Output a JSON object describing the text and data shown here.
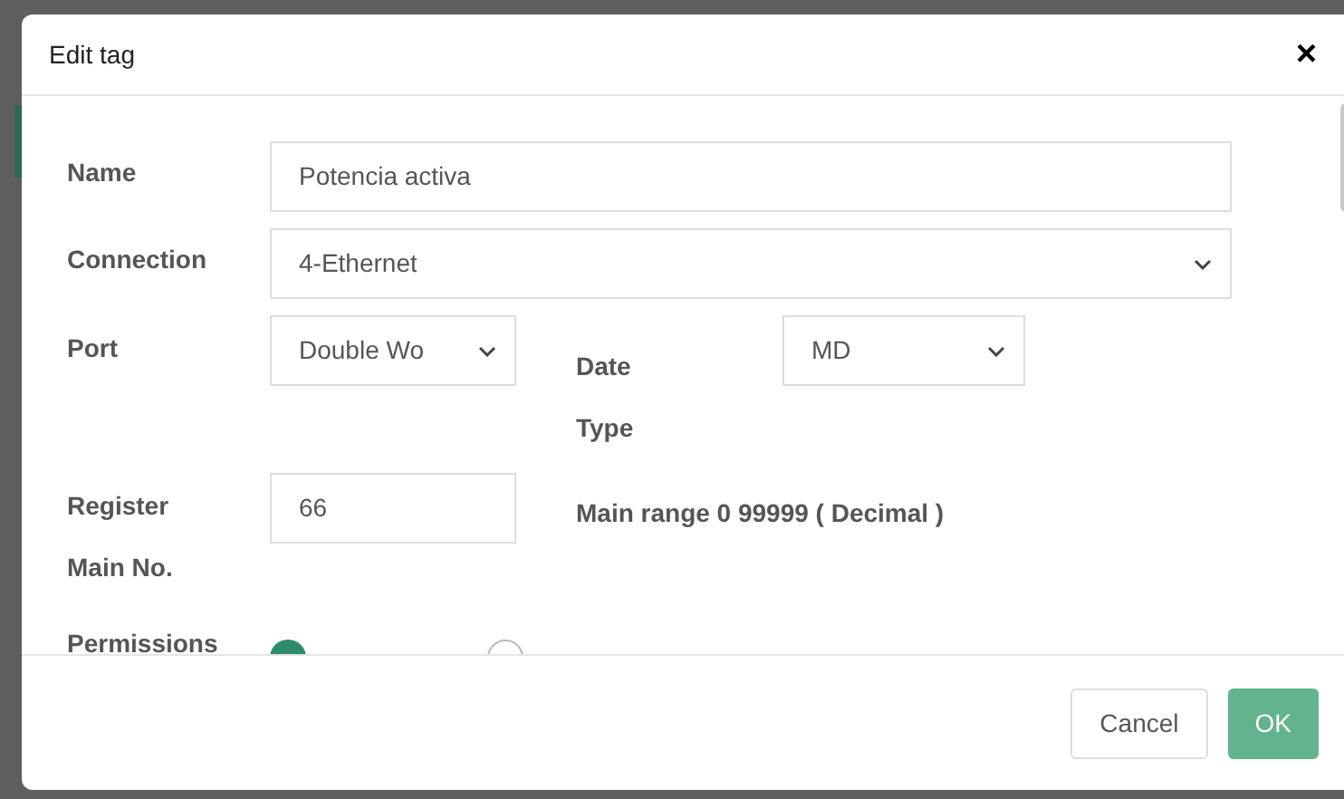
{
  "dialog": {
    "title": "Edit tag",
    "close": "×"
  },
  "form": {
    "name": {
      "label": "Name",
      "value": "Potencia activa"
    },
    "connection": {
      "label": "Connection",
      "value": "4-Ethernet"
    },
    "port": {
      "label": "Port",
      "value": "Double Wo"
    },
    "data_type": {
      "label_lines": [
        "Date",
        "Type"
      ],
      "value": "MD"
    },
    "register": {
      "label_lines": [
        "Register",
        "Main No."
      ],
      "value": "66",
      "hint": "Main range 0 99999 ( Decimal )"
    },
    "permissions": {
      "label": "Permissions",
      "options": [
        {
          "selected": true
        },
        {
          "selected": false
        }
      ]
    }
  },
  "buttons": [
    {
      "label": "Cancel",
      "kind": "secondary"
    },
    {
      "label": "OK",
      "kind": "primary"
    }
  ]
}
